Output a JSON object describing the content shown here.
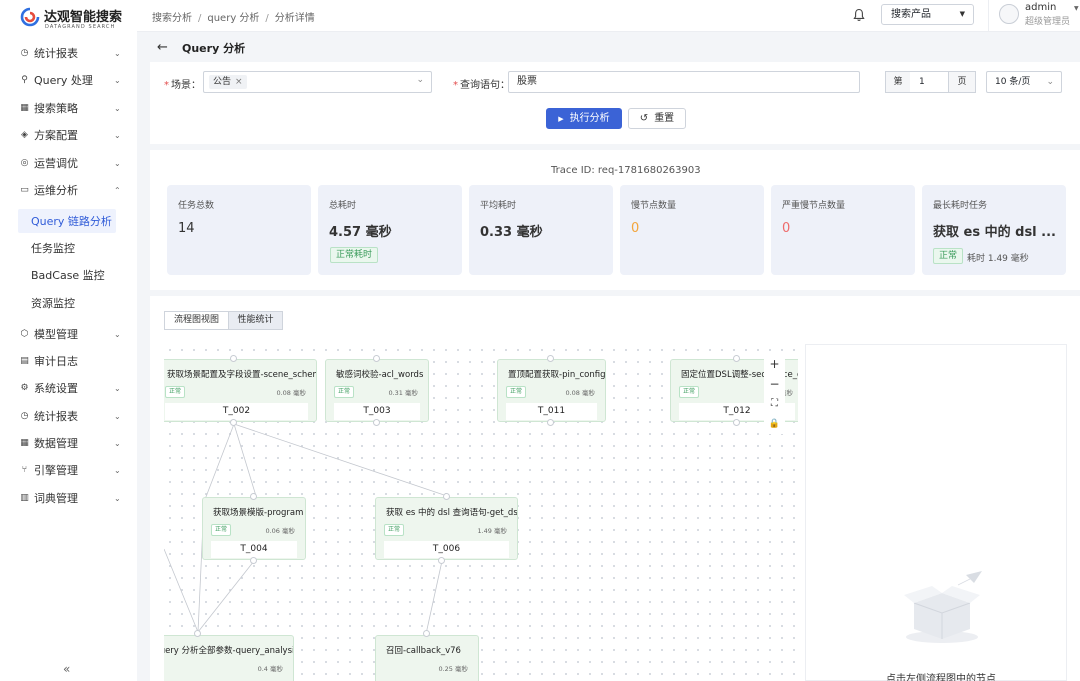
{
  "brand": {
    "name_cn": "达观智能搜索",
    "name_en": "DATAGRAND SEARCH"
  },
  "sidebar": {
    "items": [
      {
        "label": "统计报表",
        "icon": "clock-icon"
      },
      {
        "label": "Query 处理",
        "icon": "search-icon"
      },
      {
        "label": "搜索策略",
        "icon": "grid-icon"
      },
      {
        "label": "方案配置",
        "icon": "layers-icon"
      },
      {
        "label": "运营调优",
        "icon": "target-icon"
      },
      {
        "label": "运维分析",
        "icon": "monitor-icon"
      }
    ],
    "subitems": [
      {
        "label": "Query 链路分析"
      },
      {
        "label": "任务监控"
      },
      {
        "label": "BadCase 监控"
      },
      {
        "label": "资源监控"
      }
    ],
    "items2": [
      {
        "label": "模型管理",
        "icon": "cube-icon"
      },
      {
        "label": "审计日志",
        "icon": "log-icon"
      },
      {
        "label": "系统设置",
        "icon": "gear-icon"
      },
      {
        "label": "统计报表",
        "icon": "clock-icon"
      },
      {
        "label": "数据管理",
        "icon": "grid-icon"
      },
      {
        "label": "引擎管理",
        "icon": "engine-icon"
      },
      {
        "label": "词典管理",
        "icon": "book-icon"
      }
    ],
    "collapse": "«"
  },
  "header": {
    "breadcrumb": [
      "搜索分析",
      "query 分析",
      "分析详情"
    ],
    "product_select": "搜索产品",
    "user": {
      "name": "admin",
      "role": "超级管理员"
    }
  },
  "page": {
    "title": "Query 分析"
  },
  "filters": {
    "scene_label": "场景：",
    "scene_tag": "公告",
    "query_label": "查询语句：",
    "query_value": "股票",
    "page_prefix": "第",
    "page_value": "1",
    "page_suffix": "页",
    "page_size": "10 条/页",
    "run_label": "执行分析",
    "reset_label": "重置"
  },
  "stats": {
    "trace_id": "Trace ID: req-1781680263903",
    "cards": [
      {
        "label": "任务总数",
        "value": "14"
      },
      {
        "label": "总耗时",
        "value": "4.57 毫秒",
        "badge": "正常耗时"
      },
      {
        "label": "平均耗时",
        "value": "0.33 毫秒"
      },
      {
        "label": "慢节点数量",
        "value": "0"
      },
      {
        "label": "严重慢节点数量",
        "value": "0"
      },
      {
        "label": "最长耗时任务",
        "value": "获取 es 中的 dsl ...",
        "badge": "正常",
        "sub": "耗时 1.49 毫秒"
      }
    ]
  },
  "flow": {
    "tabs": [
      "流程图视图",
      "性能统计"
    ],
    "nodes": [
      {
        "title": "获取场景配置及字段设置-scene_schema",
        "status": "正常",
        "ms": "0.08 毫秒",
        "id": "T_002"
      },
      {
        "title": "敏感词校验-acl_words",
        "status": "正常",
        "ms": "0.31 毫秒",
        "id": "T_003"
      },
      {
        "title": "置顶配置获取-pin_config",
        "status": "正常",
        "ms": "0.08 毫秒",
        "id": "T_011"
      },
      {
        "title": "固定位置DSL调整-sequence_dsl",
        "status": "正常",
        "ms": "0.1 毫秒",
        "id": "T_012"
      },
      {
        "title": "获取场景模版-program",
        "status": "正常",
        "ms": "0.06 毫秒",
        "id": "T_004"
      },
      {
        "title": "获取 es 中的 dsl 查询语句-get_dsl",
        "status": "正常",
        "ms": "1.49 毫秒",
        "id": "T_006"
      },
      {
        "title": "Query 分析全部参数-query_analysis",
        "status": "",
        "ms": "0.4 毫秒",
        "id": ""
      },
      {
        "title": "召回-callback_v76",
        "status": "",
        "ms": "0.25 毫秒",
        "id": ""
      }
    ],
    "zoom": [
      "+",
      "−",
      "⛶",
      "🔒"
    ],
    "detail_hint": "点击左侧流程图中的节点"
  }
}
